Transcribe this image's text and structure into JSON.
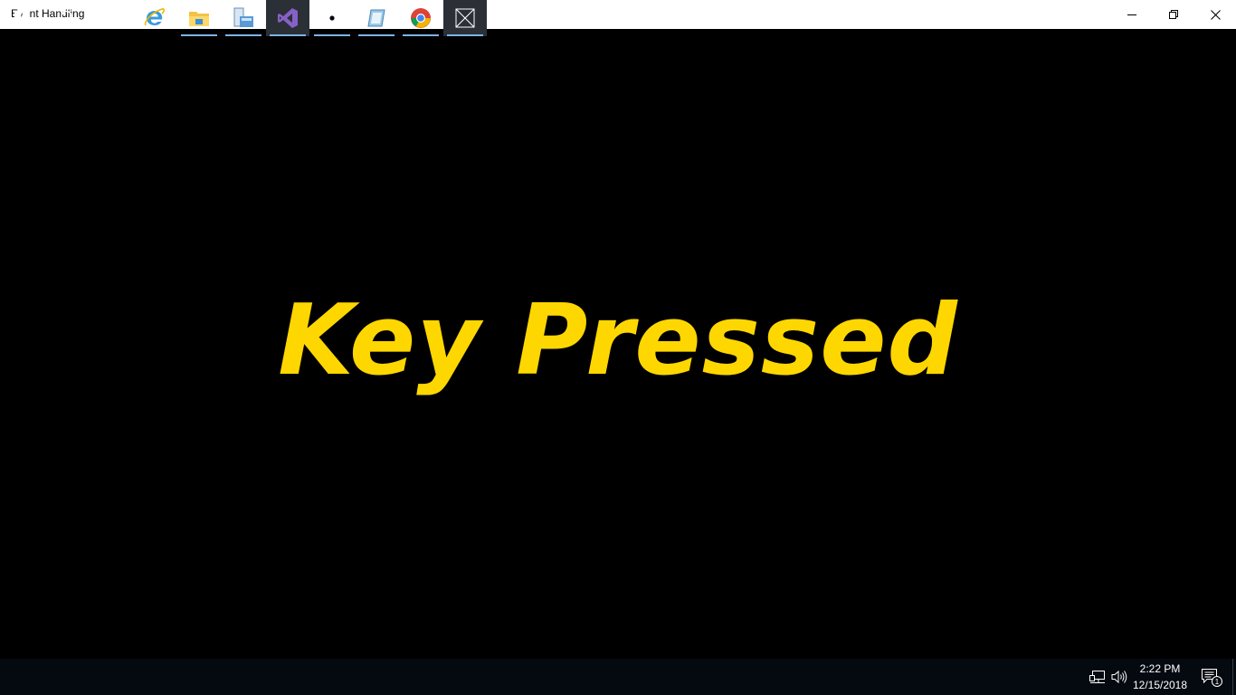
{
  "window": {
    "title": "Event Handling",
    "minimize_icon": "minimize-icon",
    "restore_icon": "restore-icon",
    "close_icon": "close-icon"
  },
  "main": {
    "message": "Key Pressed",
    "message_color": "#FFD700",
    "background": "#000000"
  },
  "taskbar": {
    "items": [
      {
        "name": "start",
        "icon": "windows-logo-icon"
      },
      {
        "name": "search",
        "icon": "search-icon"
      },
      {
        "name": "task-view",
        "icon": "task-view-icon"
      },
      {
        "name": "internet-explorer",
        "icon": "internet-explorer-icon"
      },
      {
        "name": "file-explorer",
        "icon": "folder-icon",
        "running": true
      },
      {
        "name": "file-manager",
        "icon": "file-manager-icon",
        "running": true
      },
      {
        "name": "visual-studio",
        "icon": "visual-studio-icon",
        "running": true
      },
      {
        "name": "settings",
        "icon": "gear-icon",
        "running": true
      },
      {
        "name": "app-launcher",
        "icon": "app-icon",
        "running": true
      },
      {
        "name": "chrome",
        "icon": "chrome-icon",
        "running": true
      },
      {
        "name": "event-handling-app",
        "icon": "app-placeholder-icon",
        "running": true,
        "active": true
      }
    ],
    "tray": {
      "network_icon": "network-icon",
      "volume_icon": "volume-icon",
      "notification_icon": "notification-icon",
      "notification_count": "1",
      "time": "2:22 PM",
      "date": "12/15/2018"
    }
  }
}
